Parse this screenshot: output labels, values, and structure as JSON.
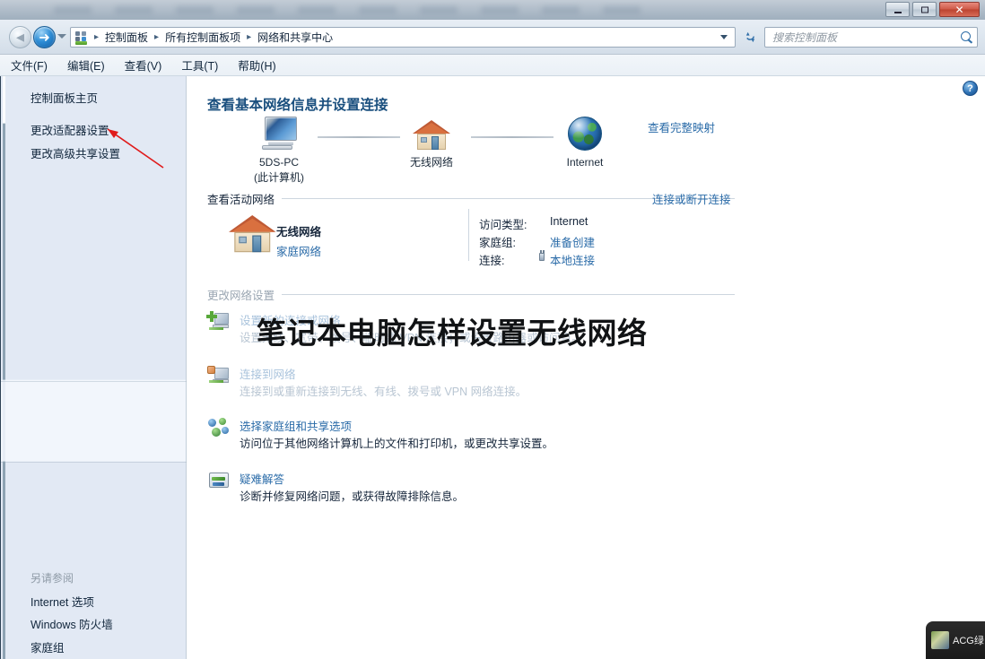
{
  "window": {
    "controls": {
      "minimize": "—",
      "maximize": "□",
      "close": "✕"
    }
  },
  "navbar": {
    "back_label": "◄",
    "forward_label": "►",
    "history_dropdown": "▼",
    "breadcrumb_icon": "control-panel-icon",
    "breadcrumbs": [
      "控制面板",
      "所有控制面板项",
      "网络和共享中心"
    ],
    "separator": "►",
    "refresh_label": "↯",
    "search": {
      "placeholder": "搜索控制面板",
      "value": ""
    }
  },
  "menubar": {
    "items": [
      "文件(F)",
      "编辑(E)",
      "查看(V)",
      "工具(T)",
      "帮助(H)"
    ]
  },
  "sidebar": {
    "home_link": "控制面板主页",
    "links": [
      "更改适配器设置",
      "更改高级共享设置"
    ],
    "see_also_header": "另请参阅",
    "see_also": [
      "Internet 选项",
      "Windows 防火墙",
      "家庭组"
    ]
  },
  "content": {
    "help_glyph": "?",
    "page_title": "查看基本网络信息并设置连接",
    "network_map": {
      "view_full_map": "查看完整映射",
      "nodes": [
        {
          "icon": "computer-icon",
          "label": "5DS-PC",
          "sublabel": "(此计算机)"
        },
        {
          "icon": "house-icon",
          "label": "无线网络",
          "sublabel": ""
        },
        {
          "icon": "globe-icon",
          "label": "Internet",
          "sublabel": ""
        }
      ]
    },
    "active_networks": {
      "header": "查看活动网络",
      "right_link": "连接或断开连接",
      "network": {
        "icon": "house-icon",
        "name": "无线网络",
        "type": "家庭网络"
      },
      "details": [
        {
          "label": "访问类型:",
          "value": "Internet",
          "is_link": false,
          "icon": ""
        },
        {
          "label": "家庭组:",
          "value": "准备创建",
          "is_link": true,
          "icon": ""
        },
        {
          "label": "连接:",
          "value": "本地连接",
          "is_link": true,
          "icon": "plug-icon"
        }
      ]
    },
    "change_settings": {
      "header": "更改网络设置",
      "tasks": [
        {
          "icon": "new-connection-icon",
          "link": "设置新的连接或网络",
          "desc": "设置无线、宽带、拨号、临时或 VPN 连接；或设置路由器或访问点。",
          "faded": true
        },
        {
          "icon": "connect-network-icon",
          "link": "连接到网络",
          "desc": "连接到或重新连接到无线、有线、拨号或 VPN 网络连接。",
          "faded": true
        },
        {
          "icon": "homegroup-icon",
          "link": "选择家庭组和共享选项",
          "desc": "访问位于其他网络计算机上的文件和打印机，或更改共享设置。",
          "faded": false
        },
        {
          "icon": "troubleshoot-icon",
          "link": "疑难解答",
          "desc": "诊断并修复网络问题，或获得故障排除信息。",
          "faded": false
        }
      ]
    }
  },
  "overlay": {
    "caption": "笔记本电脑怎样设置无线网络",
    "annotation_arrow": "red-arrow-pointing-to-adapter-settings"
  },
  "watermark": {
    "text": "ACG绿"
  },
  "colors": {
    "link": "#2a6ba8",
    "title": "#1a4f7e",
    "text": "#15253a",
    "faded_link": "#a9c3dc",
    "sidebar_bg": "#e2e9f4",
    "accent_red": "#e01b1b"
  }
}
